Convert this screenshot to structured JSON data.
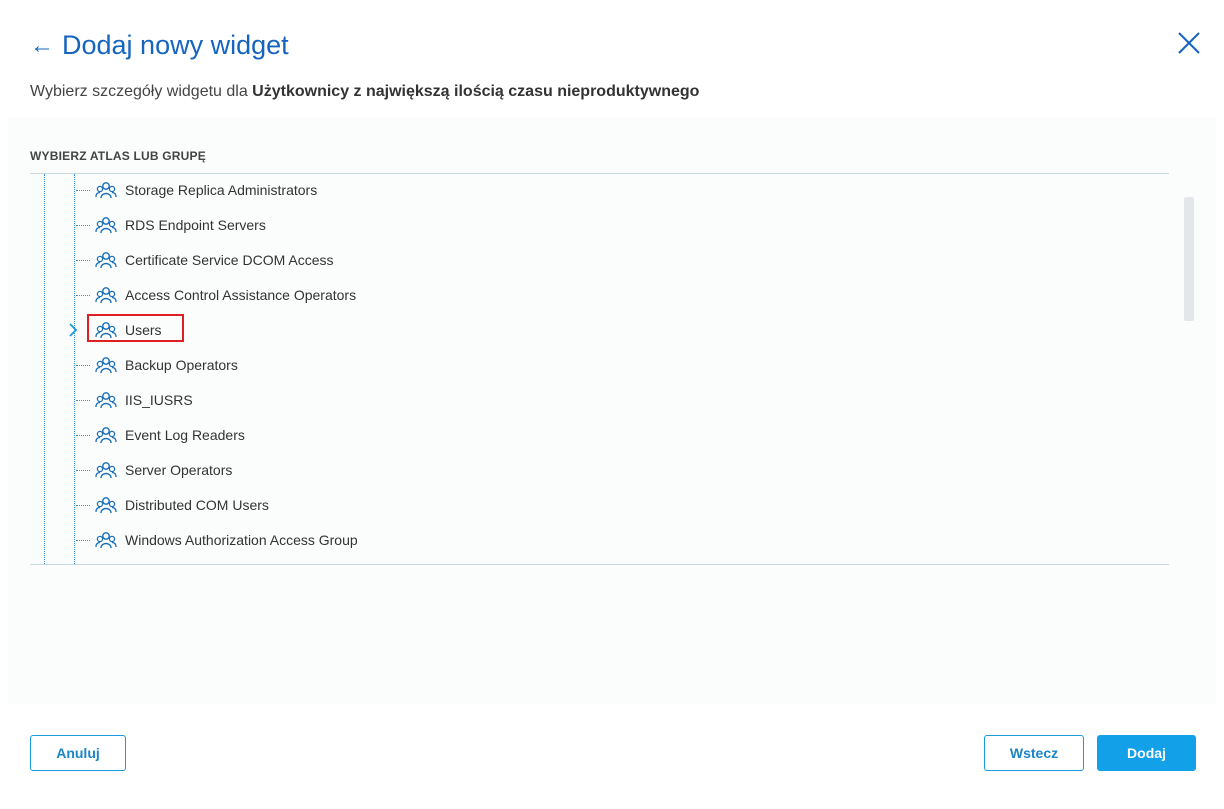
{
  "header": {
    "back_icon": "arrow-left-icon",
    "title": "Dodaj nowy widget",
    "close_icon": "close-icon",
    "subtitle_prefix": "Wybierz szczegóły widgetu dla ",
    "subtitle_bold": "Użytkownicy z największą ilością czasu nieproduktywnego"
  },
  "section": {
    "label": "WYBIERZ ATLAS LUB GRUPĘ"
  },
  "tree": {
    "item_icon": "user-group-icon",
    "items": [
      {
        "label": "Storage Replica Administrators",
        "expandable": false
      },
      {
        "label": "RDS Endpoint Servers",
        "expandable": false
      },
      {
        "label": "Certificate Service DCOM Access",
        "expandable": false
      },
      {
        "label": "Access Control Assistance Operators",
        "expandable": false
      },
      {
        "label": "Users",
        "expandable": true,
        "highlighted": true
      },
      {
        "label": "Backup Operators",
        "expandable": false
      },
      {
        "label": "IIS_IUSRS",
        "expandable": false
      },
      {
        "label": "Event Log Readers",
        "expandable": false
      },
      {
        "label": "Server Operators",
        "expandable": false
      },
      {
        "label": "Distributed COM Users",
        "expandable": false
      },
      {
        "label": "Windows Authorization Access Group",
        "expandable": false
      }
    ]
  },
  "footer": {
    "cancel_label": "Anuluj",
    "back_label": "Wstecz",
    "add_label": "Dodaj"
  },
  "colors": {
    "accent": "#1565c0",
    "primary_button": "#12a0e8",
    "highlight": "#e02020"
  }
}
